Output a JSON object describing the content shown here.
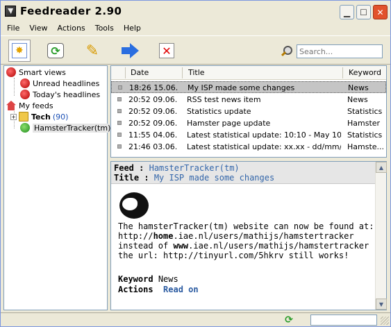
{
  "window": {
    "title": "Feedreader 2.90"
  },
  "menu": [
    "File",
    "View",
    "Actions",
    "Tools",
    "Help"
  ],
  "toolbar": {
    "icons": [
      "new-feed-icon",
      "refresh-icon",
      "edit-icon",
      "next-icon",
      "delete-icon"
    ],
    "search_placeholder": "Search..."
  },
  "tree": {
    "smart_views": "Smart views",
    "unread": "Unread headlines",
    "today": "Today's headlines",
    "my_feeds": "My feeds",
    "tech": "Tech",
    "tech_count": "(90)",
    "hamster": "HamsterTracker(tm)",
    "expander": "+"
  },
  "list": {
    "headers": {
      "date": "Date",
      "title": "Title",
      "keyword": "Keyword"
    },
    "rows": [
      {
        "date": "18:26 15.06.",
        "title": "My ISP made some changes",
        "keyword": "News"
      },
      {
        "date": "20:52 09.06.",
        "title": "RSS test news item",
        "keyword": "News"
      },
      {
        "date": "20:52 09.06.",
        "title": "Statistics update",
        "keyword": "Statistics"
      },
      {
        "date": "20:52 09.06.",
        "title": "Hamster page update",
        "keyword": "Hamster"
      },
      {
        "date": "11:55 04.06.",
        "title": "Latest statistical update: 10:10 - May 10, ...",
        "keyword": "Statistics"
      },
      {
        "date": "21:46 03.06.",
        "title": "Latest statistical update: xx.xx - dd/mm/y...",
        "keyword": "Hamste..."
      }
    ]
  },
  "preview": {
    "feed_label": "Feed :",
    "feed_value": "HamsterTracker(tm)",
    "title_label": "Title :",
    "title_value": "My ISP made some changes",
    "line1": "The hamsterTracker(tm) website can now be found at:",
    "line2a": "http://",
    "line2b": "home",
    "line2c": ".iae.nl/users/mathijs/hamstertracker",
    "line3a": "instead of ",
    "line3b": "www",
    "line3c": ".iae.nl/users/mathijs/hamstertracker",
    "line4": "the url: http://tinyurl.com/5hkrv still works!",
    "keyword_label": "Keyword",
    "keyword_value": "News",
    "actions_label": "Actions",
    "read_on": "Read on"
  }
}
